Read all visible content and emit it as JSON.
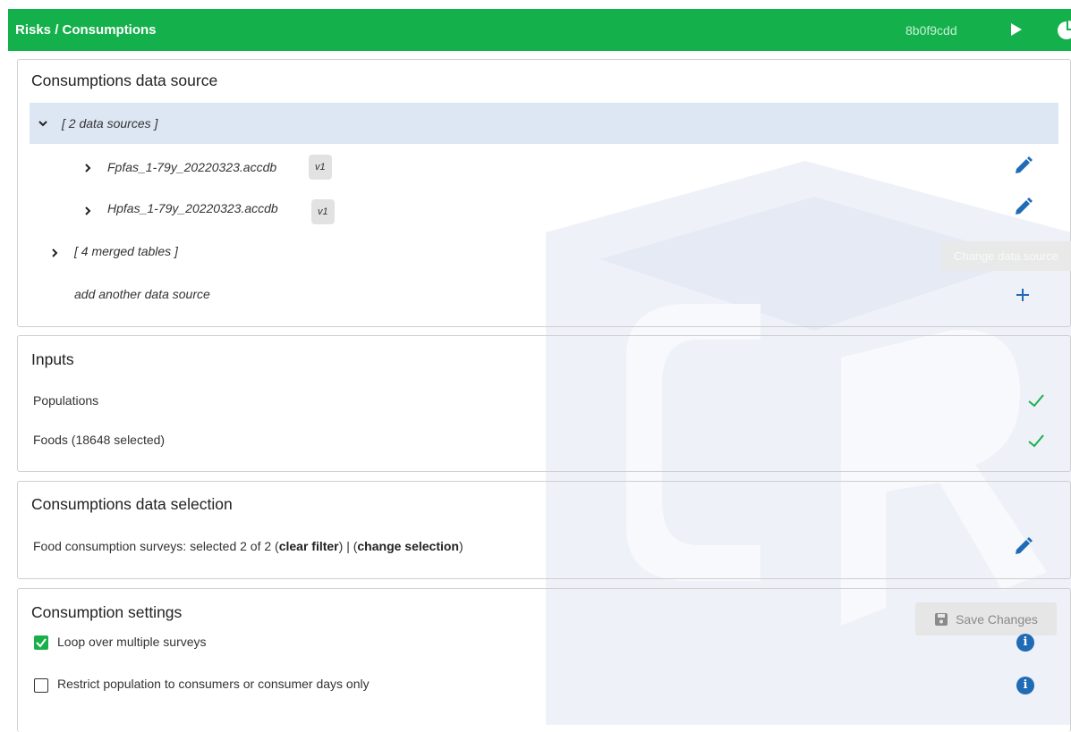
{
  "header": {
    "title": "Risks / Consumptions",
    "hash": "8b0f9cdd"
  },
  "data_source_panel": {
    "title": "Consumptions data source",
    "group_label": "[ 2 data sources ]",
    "sources": [
      {
        "name": "Fpfas_1-79y_20220323.accdb",
        "version": "v1"
      },
      {
        "name": "Hpfas_1-79y_20220323.accdb",
        "version": "v1"
      }
    ],
    "merged_label": "[ 4 merged tables ]",
    "add_label": "add another data source",
    "tooltip": "Change data source"
  },
  "inputs_panel": {
    "title": "Inputs",
    "items": [
      {
        "label": "Populations"
      },
      {
        "label": "Foods (18648 selected)"
      }
    ]
  },
  "selection_panel": {
    "title": "Consumptions data selection",
    "prefix": "Food consumption surveys: selected 2 of 2 (",
    "clear_filter": "clear filter",
    "middle": ") | (",
    "change_selection": "change selection",
    "suffix": ")"
  },
  "settings_panel": {
    "title": "Consumption settings",
    "save_label": "Save Changes",
    "options": [
      {
        "label": "Loop over multiple surveys",
        "checked": true
      },
      {
        "label": "Restrict population to consumers or consumer days only",
        "checked": false
      }
    ]
  },
  "colors": {
    "header_bg": "#14b04c",
    "accent_blue": "#1f6bb5",
    "check_green": "#19b04c",
    "highlight_row": "#dde6f3"
  }
}
